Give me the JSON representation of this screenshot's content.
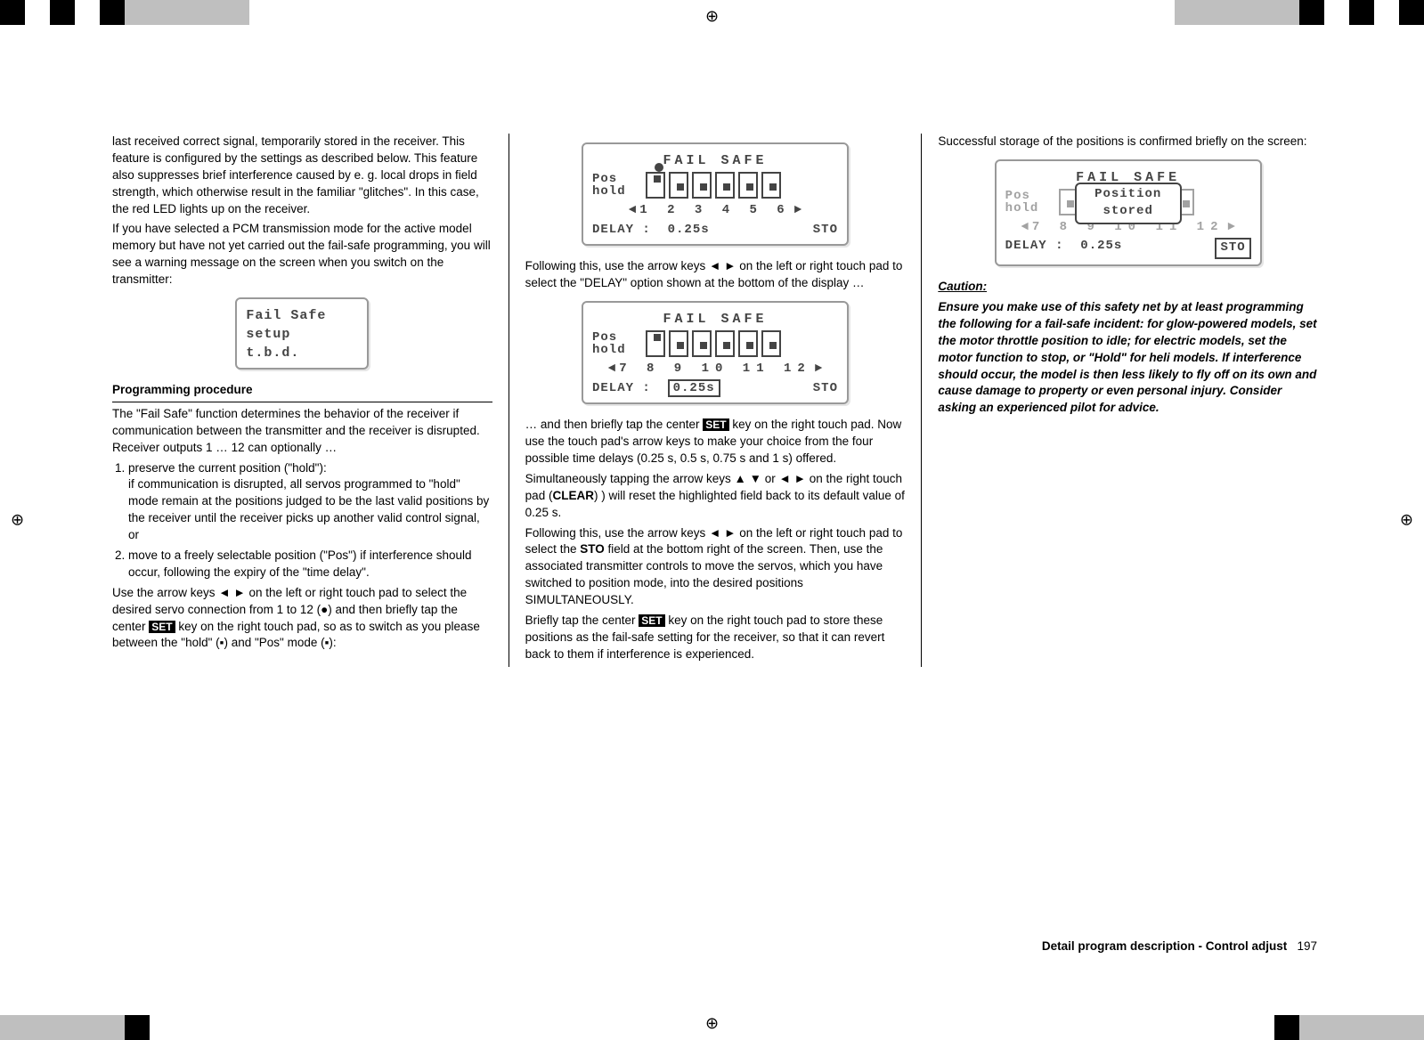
{
  "col1": {
    "p1": "last received correct signal, temporarily stored in the receiver. This feature is configured by the settings as described below.   This feature also suppresses brief interference caused by e. g. local drops in field strength, which otherwise result in the familiar \"glitches\". In this case, the red LED lights up on the receiver.",
    "p2": "If you have selected a PCM transmission mode for the active model memory but have not yet carried out the fail-safe programming, you will see a warning message on the screen when you switch on the transmitter:",
    "miniLcd": {
      "l1": "Fail Safe",
      "l2": "setup",
      "l3": "t.b.d."
    },
    "h1": "Programming procedure",
    "p3": "The \"Fail Safe\" function determines the behavior of the receiver if communication between the transmitter and the receiver is disrupted. Receiver outputs 1 … 12 can optionally …",
    "li1": "preserve the current position (\"hold\"):",
    "li1sub": "if communication is disrupted, all servos programmed to \"hold\" mode remain at the positions judged to be the last valid positions by the receiver until the receiver picks up another valid control signal, or",
    "li2": "move to a freely selectable position (\"Pos\") if interference should occur, following the expiry of the \"time delay\".",
    "p4a": "Use the arrow keys ◄ ► on the left or right touch pad to select the desired servo connection from 1 to 12 (●) and then briefly tap the center ",
    "set": "SET",
    "p4b": " key on the right touch pad, so as to switch as you please between the \"hold\" (▪) and \"Pos\" mode (▪):"
  },
  "col2": {
    "lcd1": {
      "title": "FAIL  SAFE",
      "lab1": "Pos",
      "lab2": "hold",
      "axis": "1 2 3 4 5 6",
      "delay_label": "DELAY :",
      "delay_val": "0.25s",
      "sto": "STO"
    },
    "p1": "Following this, use the arrow keys ◄ ► on the left or right touch pad to select the \"DELAY\" option shown at the bottom of the display …",
    "lcd2": {
      "title": "FAIL  SAFE",
      "lab1": "Pos",
      "lab2": "hold",
      "axis": "7 8 9 10 11 12",
      "delay_label": "DELAY :",
      "delay_val": "0.25s",
      "sto": "STO"
    },
    "p2a": "… and then briefly tap the center ",
    "set": "SET",
    "p2b": " key on the right touch pad. Now use the touch pad's arrow keys to make your choice from the four possible time delays (0.25 s, 0.5 s, 0.75 s and 1 s) offered.",
    "p3": "Simultaneously tapping the arrow keys ▲ ▼ or ◄ ► on the right touch pad (",
    "p3b": ") ) will reset the highlighted field back to its default value of 0.25 s.",
    "clear": "CLEAR",
    "p4": "Following this, use the arrow keys ◄ ► on the left or right touch pad to select the ",
    "sto": "STO",
    "p4b": " field at the bottom right of the screen. Then, use the associated transmitter controls to move the servos, which you have switched to position mode, into the desired positions SIMULTANEOUSLY.",
    "p5a": "Briefly tap the center ",
    "p5b": " key on the right touch pad to store these positions as the fail-safe setting for the receiver, so that it can revert back to them if interference is experienced."
  },
  "col3": {
    "p1": "Successful storage of the positions is confirmed briefly on the screen:",
    "lcd": {
      "title": "FAIL  SAFE",
      "lab1": "Pos",
      "lab2": "hold",
      "popup1": "Position",
      "popup2": "stored",
      "delay_label": "DELAY :",
      "delay_val": "0.25s",
      "sto": "STO"
    },
    "caution_head": "Caution:",
    "caution_body": "Ensure you make use of this safety net by at least programming the following for a fail-safe incident: for glow-powered models, set the motor throttle position to idle; for electric models, set the motor function to stop, or \"Hold\" for heli models. If interference should occur, the model is then less likely to fly off on its own and cause damage to property or even personal injury. Consider asking an experienced pilot for advice."
  },
  "footer": {
    "text": "Detail program description - Control adjust",
    "page": "197"
  }
}
